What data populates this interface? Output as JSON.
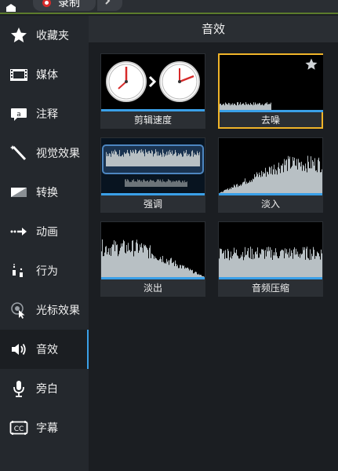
{
  "topbar": {
    "record_label": "录制"
  },
  "sidebar": {
    "items": [
      {
        "label": "收藏夹",
        "icon": "star-icon"
      },
      {
        "label": "媒体",
        "icon": "film-icon"
      },
      {
        "label": "注释",
        "icon": "annotation-icon"
      },
      {
        "label": "视觉效果",
        "icon": "magic-wand-icon"
      },
      {
        "label": "转换",
        "icon": "transition-icon"
      },
      {
        "label": "动画",
        "icon": "animation-arrow-icon"
      },
      {
        "label": "行为",
        "icon": "behavior-icon"
      },
      {
        "label": "光标效果",
        "icon": "cursor-icon"
      },
      {
        "label": "音效",
        "icon": "speaker-icon"
      },
      {
        "label": "旁白",
        "icon": "microphone-icon"
      },
      {
        "label": "字幕",
        "icon": "captions-icon"
      }
    ],
    "active_index": 8
  },
  "main": {
    "title": "音效",
    "tiles": [
      {
        "label": "剪辑速度",
        "thumbnail": "clip-speed-clocks"
      },
      {
        "label": "去噪",
        "thumbnail": "noise-removal-waveform",
        "selected": true,
        "favorite": true
      },
      {
        "label": "强调",
        "thumbnail": "emphasize-waveform"
      },
      {
        "label": "淡入",
        "thumbnail": "fade-in-waveform"
      },
      {
        "label": "淡出",
        "thumbnail": "fade-out-waveform"
      },
      {
        "label": "音频压缩",
        "thumbnail": "audio-compression-waveform"
      }
    ]
  },
  "colors": {
    "accent": "#3aa0e8",
    "selection": "#f0b429",
    "waveform": "#b8c0c4",
    "background": "#1b1e22",
    "sidebar": "#24282d"
  }
}
